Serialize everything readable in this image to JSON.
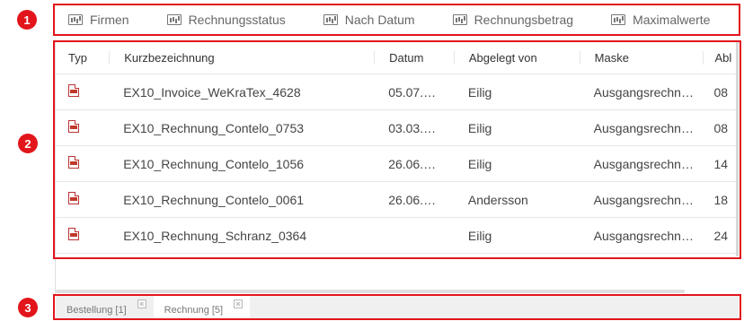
{
  "badges": [
    "1",
    "2",
    "3"
  ],
  "toolbar": {
    "items": [
      {
        "label": "Firmen",
        "icon": "chart-icon"
      },
      {
        "label": "Rechnungsstatus",
        "icon": "chart-icon"
      },
      {
        "label": "Nach Datum",
        "icon": "chart-icon"
      },
      {
        "label": "Rechnungsbetrag",
        "icon": "chart-icon"
      },
      {
        "label": "Maximalwerte",
        "icon": "chart-icon"
      }
    ]
  },
  "table": {
    "columns": [
      "Typ",
      "Kurzbezeichnung",
      "Datum",
      "Abgelegt von",
      "Maske",
      "Abl"
    ],
    "rows": [
      {
        "icon": "pdf-icon",
        "kurz": "EX10_Invoice_WeKraTex_4628",
        "datum": "05.07.…",
        "abgelegt": "Eilig",
        "maske": "Ausgangsrechn…",
        "abl": "08"
      },
      {
        "icon": "pdf-icon",
        "kurz": "EX10_Rechnung_Contelo_0753",
        "datum": "03.03.…",
        "abgelegt": "Eilig",
        "maske": "Ausgangsrechn…",
        "abl": "08"
      },
      {
        "icon": "pdf-icon",
        "kurz": "EX10_Rechnung_Contelo_1056",
        "datum": "26.06.…",
        "abgelegt": "Eilig",
        "maske": "Ausgangsrechn…",
        "abl": "14"
      },
      {
        "icon": "pdf-icon",
        "kurz": "EX10_Rechnung_Contelo_0061",
        "datum": "26.06.…",
        "abgelegt": "Andersson",
        "maske": "Ausgangsrechn…",
        "abl": "18"
      },
      {
        "icon": "pdf-icon",
        "kurz": "EX10_Rechnung_Schranz_0364",
        "datum": "",
        "abgelegt": "Eilig",
        "maske": "Ausgangsrechn…",
        "abl": "24"
      }
    ]
  },
  "tabs": [
    {
      "label": "Bestellung [1]",
      "active": false
    },
    {
      "label": "Rechnung [5]",
      "active": true
    }
  ],
  "colors": {
    "highlight": "#e2151b",
    "pdf": "#c0392b"
  }
}
